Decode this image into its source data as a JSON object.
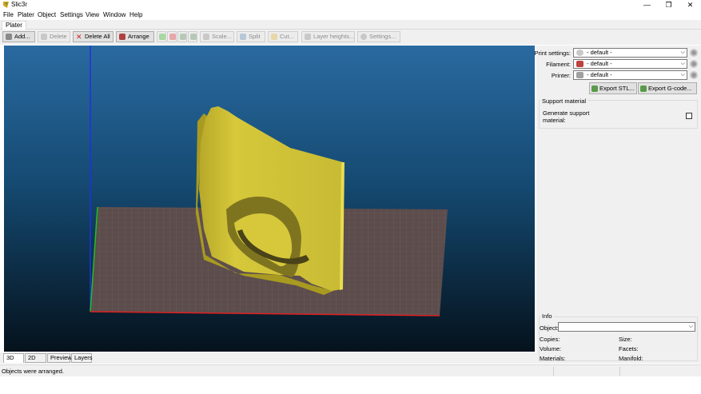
{
  "window": {
    "title": "Slic3r",
    "minimize_glyph": "—",
    "maximize_glyph": "❐",
    "close_glyph": "✕"
  },
  "menu": [
    "File",
    "Plater",
    "Object",
    "Settings",
    "View",
    "Window",
    "Help"
  ],
  "tab": {
    "label": "Plater"
  },
  "toolbar": {
    "add": "Add...",
    "delete": "Delete",
    "delete_all": "Delete All",
    "arrange": "Arrange",
    "scale": "Scale...",
    "split": "Split",
    "cut": "Cut...",
    "layer_heights": "Layer heights...",
    "settings": "Settings..."
  },
  "view_tabs": [
    "3D",
    "2D",
    "Preview",
    "Layers"
  ],
  "settings_panel": {
    "print_settings_label": "Print settings:",
    "print_settings_value": "- default -",
    "filament_label": "Filament:",
    "filament_value": "- default -",
    "printer_label": "Printer:",
    "printer_value": "- default -",
    "export_stl": "Export STL...",
    "export_gcode": "Export G-code..."
  },
  "support": {
    "title": "Support material",
    "generate_label_line1": "Generate support",
    "generate_label_line2": "material:",
    "checked": false
  },
  "info": {
    "title": "Info",
    "object_label": "Object:",
    "copies_label": "Copies:",
    "size_label": "Size:",
    "volume_label": "Volume:",
    "facets_label": "Facets:",
    "materials_label": "Materials:",
    "manifold_label": "Manifold:"
  },
  "status": {
    "message": "Objects were arranged."
  },
  "colors": {
    "model": "#d6c83a",
    "bed": "#5c4c4c",
    "axis_x": "#e02020",
    "axis_y": "#20c020",
    "axis_z": "#2030e0"
  }
}
